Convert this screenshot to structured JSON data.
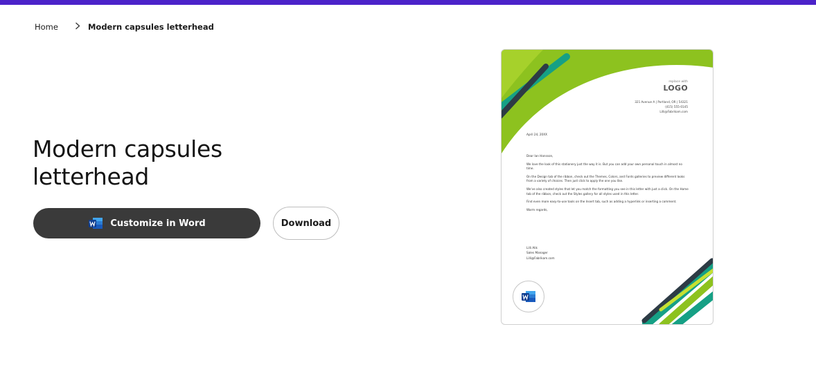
{
  "breadcrumb": {
    "home": "Home",
    "current": "Modern capsules letterhead"
  },
  "page": {
    "title": "Modern capsules letterhead"
  },
  "actions": {
    "customize_label": "Customize in Word",
    "download_label": "Download"
  },
  "preview": {
    "logo_small": "replace with",
    "logo_big": "LOGO",
    "address_lines": [
      "321 Avenue A | Portland, OR | 54321",
      "(415) 555-0145",
      "Lilli@Fabrikam.com"
    ],
    "date": "April 24, 20XX",
    "greeting": "Dear Ian Hansson,",
    "paragraphs": [
      "We love the look of this stationery just the way it is. But you can add your own personal touch in almost no time.",
      "On the Design tab of the ribbon, check out the Themes, Colors, and Fonts galleries to preview different looks from a variety of choices. Then just click to apply the one you like.",
      "We've also created styles that let you match the formatting you see in this letter with just a click. On the Home tab of the ribbon, check out the Styles gallery for all styles used in this letter.",
      "Find even more easy-to-use tools on the Insert tab, such as adding a hyperlink or inserting a comment."
    ],
    "closing": "Warm regards,",
    "signature": [
      "Lilli Alik",
      "Sales Manager",
      "Lilli@Fabrikam.com"
    ]
  },
  "colors": {
    "top_bar": "#4b22c9",
    "button_dark": "#3a3a3a",
    "lime": "#8dc21f",
    "teal": "#16a085",
    "dark_stripe": "#2d3b45"
  },
  "icons": {
    "chevron": "chevron-right-icon",
    "word": "word-app-icon"
  }
}
